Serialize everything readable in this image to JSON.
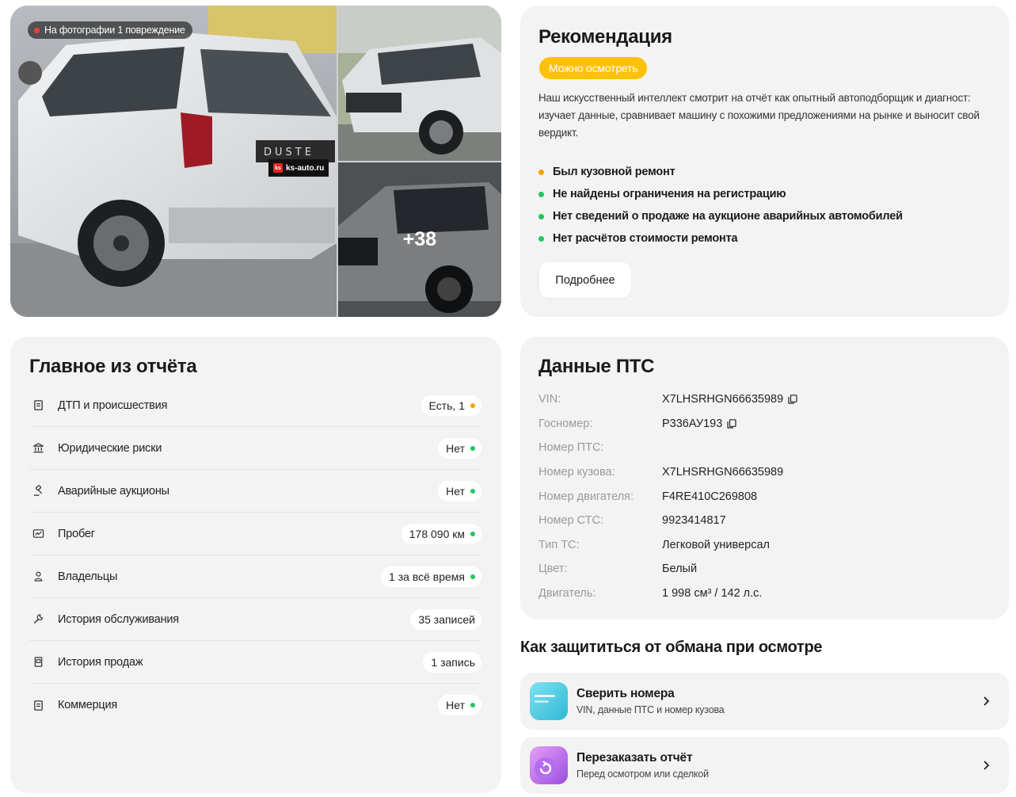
{
  "gallery": {
    "damage_badge": "На фотографии 1 повреждение",
    "more_photos": "+38",
    "watermark": "ks-auto.ru"
  },
  "recommendation": {
    "title": "Рекомендация",
    "badge": "Можно осмотреть",
    "text": "Наш искусственный интеллект смотрит на отчёт как опытный автоподборщик и диагност: изучает данные, сравнивает машину с похожими предложениями на рынке и выносит свой вердикт.",
    "items": [
      {
        "label": "Был кузовной ремонт",
        "status_color": "#ffa000"
      },
      {
        "label": "Не найдены ограничения на регистрацию",
        "status_color": "#22c55e"
      },
      {
        "label": "Нет сведений о продаже на аукционе аварийных автомобилей",
        "status_color": "#22c55e"
      },
      {
        "label": "Нет расчётов стоимости ремонта",
        "status_color": "#22c55e"
      }
    ],
    "more_button": "Подробнее"
  },
  "summary": {
    "title": "Главное из отчёта",
    "rows": [
      {
        "icon": "document-icon",
        "label": "ДТП и происшествия",
        "value": "Есть, 1",
        "status_color": "#ffa000"
      },
      {
        "icon": "bank-icon",
        "label": "Юридические риски",
        "value": "Нет",
        "status_color": "#22c55e"
      },
      {
        "icon": "gavel-icon",
        "label": "Аварийные аукционы",
        "value": "Нет",
        "status_color": "#22c55e"
      },
      {
        "icon": "odometer-icon",
        "label": "Пробег",
        "value": "178 090 км",
        "status_color": "#22c55e"
      },
      {
        "icon": "person-icon",
        "label": "Владельцы",
        "value": "1 за всё время",
        "status_color": "#22c55e"
      },
      {
        "icon": "wrench-icon",
        "label": "История обслуживания",
        "value": "35 записей",
        "status_color": ""
      },
      {
        "icon": "receipt-icon",
        "label": "История продаж",
        "value": "1 запись",
        "status_color": ""
      },
      {
        "icon": "document-icon",
        "label": "Коммерция",
        "value": "Нет",
        "status_color": "#22c55e"
      }
    ]
  },
  "pts": {
    "title": "Данные ПТС",
    "rows": [
      {
        "key": "VIN:",
        "value": "X7LHSRHGN66635989",
        "copy": true
      },
      {
        "key": "Госномер:",
        "value": "Р336АУ193",
        "copy": true
      },
      {
        "key": "Номер ПТС:",
        "value": "",
        "copy": false
      },
      {
        "key": "Номер кузова:",
        "value": "X7LHSRHGN66635989",
        "copy": false
      },
      {
        "key": "Номер двигателя:",
        "value": "F4RE410C269808",
        "copy": false
      },
      {
        "key": "Номер СТС:",
        "value": "9923414817",
        "copy": false
      },
      {
        "key": "Тип ТС:",
        "value": "Легковой универсал",
        "copy": false
      },
      {
        "key": "Цвет:",
        "value": "Белый",
        "copy": false
      },
      {
        "key": "Двигатель:",
        "value": "1 998 см³ / 142 л.с.",
        "copy": false
      }
    ]
  },
  "protect": {
    "title": "Как защититься от обмана при осмотре",
    "actions": [
      {
        "title": "Сверить номера",
        "subtitle": "VIN, данные ПТС и номер кузова",
        "icon": "card-icon"
      },
      {
        "title": "Перезаказать отчёт",
        "subtitle": "Перед осмотром или сделкой",
        "icon": "refresh-icon"
      }
    ]
  }
}
